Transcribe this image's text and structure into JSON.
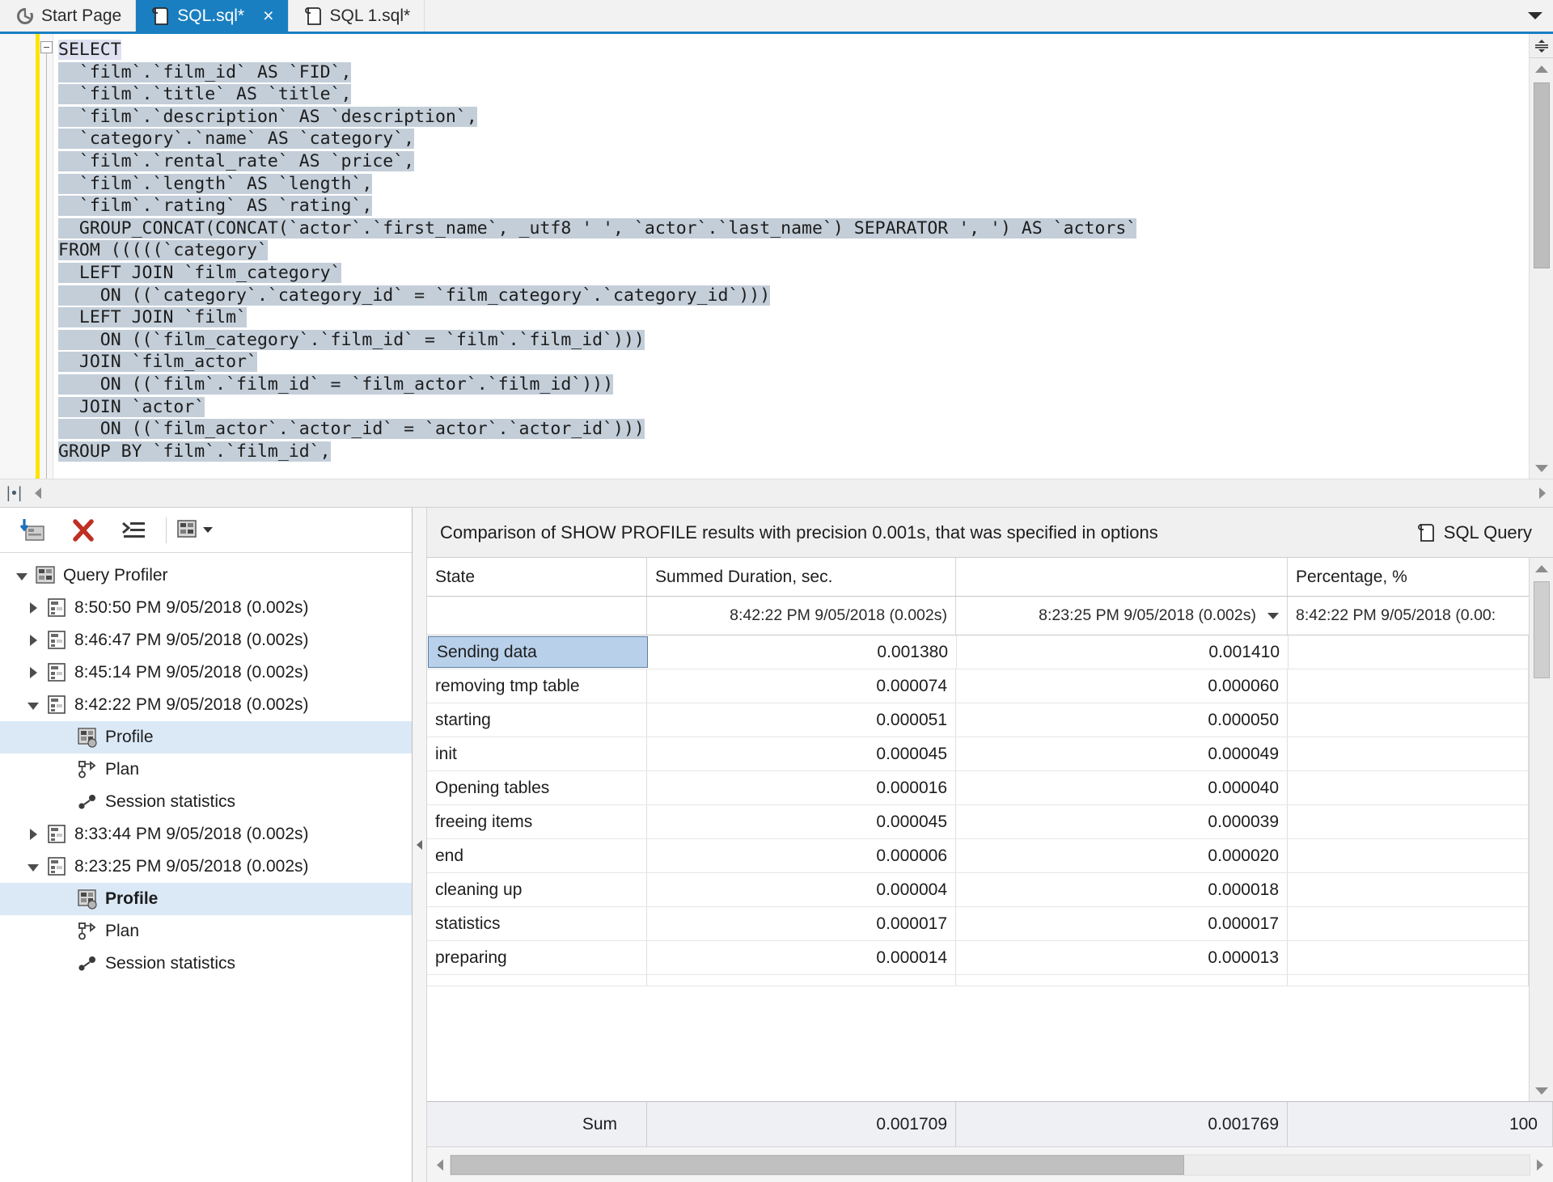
{
  "tabs": [
    {
      "label": "Start Page",
      "icon": "start-page-icon",
      "active": false,
      "closable": false
    },
    {
      "label": "SQL.sql*",
      "icon": "sql-file-icon",
      "active": true,
      "closable": true,
      "close_label": "×"
    },
    {
      "label": "SQL 1.sql*",
      "icon": "sql-file-icon",
      "active": false,
      "closable": false
    }
  ],
  "editor": {
    "lines": [
      {
        "text": "SELECT",
        "sel": "first"
      },
      {
        "text": "  `film`.`film_id` AS `FID`,",
        "sel": "yes"
      },
      {
        "text": "  `film`.`title` AS `title`,",
        "sel": "yes"
      },
      {
        "text": "  `film`.`description` AS `description`,",
        "sel": "yes"
      },
      {
        "text": "  `category`.`name` AS `category`,",
        "sel": "yes"
      },
      {
        "text": "  `film`.`rental_rate` AS `price`,",
        "sel": "yes"
      },
      {
        "text": "  `film`.`length` AS `length`,",
        "sel": "yes"
      },
      {
        "text": "  `film`.`rating` AS `rating`,",
        "sel": "yes"
      },
      {
        "text": "  GROUP_CONCAT(CONCAT(`actor`.`first_name`, _utf8 ' ', `actor`.`last_name`) SEPARATOR ', ') AS `actors`",
        "sel": "yes"
      },
      {
        "text": "FROM (((((`category`",
        "sel": "yes"
      },
      {
        "text": "  LEFT JOIN `film_category`",
        "sel": "yes"
      },
      {
        "text": "    ON ((`category`.`category_id` = `film_category`.`category_id`)))",
        "sel": "yes"
      },
      {
        "text": "  LEFT JOIN `film`",
        "sel": "yes"
      },
      {
        "text": "    ON ((`film_category`.`film_id` = `film`.`film_id`)))",
        "sel": "yes"
      },
      {
        "text": "  JOIN `film_actor`",
        "sel": "yes"
      },
      {
        "text": "    ON ((`film`.`film_id` = `film_actor`.`film_id`)))",
        "sel": "yes"
      },
      {
        "text": "  JOIN `actor`",
        "sel": "yes"
      },
      {
        "text": "    ON ((`film_actor`.`actor_id` = `actor`.`actor_id`)))",
        "sel": "yes"
      },
      {
        "text": "GROUP BY `film`.`film_id`,",
        "sel": "yes"
      }
    ]
  },
  "profiler": {
    "toolbar": [
      {
        "name": "import-profile-button",
        "icon": "import-profile-icon"
      },
      {
        "name": "delete-button",
        "icon": "red-x-icon"
      },
      {
        "name": "collapse-all-button",
        "icon": "collapse-all-icon"
      },
      {
        "name": "options-button",
        "icon": "grid-options-icon"
      }
    ],
    "root": "Query Profiler",
    "items": [
      {
        "label": "8:50:50 PM 9/05/2018 (0.002s)",
        "state": "collapsed",
        "level": 1,
        "icon": "query-result-icon"
      },
      {
        "label": "8:46:47 PM 9/05/2018 (0.002s)",
        "state": "collapsed",
        "level": 1,
        "icon": "query-result-icon"
      },
      {
        "label": "8:45:14 PM 9/05/2018 (0.002s)",
        "state": "collapsed",
        "level": 1,
        "icon": "query-result-icon"
      },
      {
        "label": "8:42:22 PM 9/05/2018 (0.002s)",
        "state": "expanded",
        "level": 1,
        "icon": "query-result-icon"
      },
      {
        "label": "Profile",
        "state": "leaf",
        "level": 2,
        "icon": "profile-icon",
        "selected": true
      },
      {
        "label": "Plan",
        "state": "leaf",
        "level": 2,
        "icon": "plan-icon"
      },
      {
        "label": "Session statistics",
        "state": "leaf",
        "level": 2,
        "icon": "session-statistics-icon"
      },
      {
        "label": "8:33:44 PM 9/05/2018 (0.002s)",
        "state": "collapsed",
        "level": 1,
        "icon": "query-result-icon"
      },
      {
        "label": "8:23:25 PM 9/05/2018 (0.002s)",
        "state": "expanded",
        "level": 1,
        "icon": "query-result-icon"
      },
      {
        "label": "Profile",
        "state": "leaf",
        "level": 2,
        "icon": "profile-icon",
        "selected": true,
        "bold": true
      },
      {
        "label": "Plan",
        "state": "leaf",
        "level": 2,
        "icon": "plan-icon"
      },
      {
        "label": "Session statistics",
        "state": "leaf",
        "level": 2,
        "icon": "session-statistics-icon"
      }
    ]
  },
  "comparison": {
    "title": "Comparison of SHOW PROFILE results with precision 0.001s, that was specified in options",
    "sql_query_label": "SQL Query",
    "sql_query_icon": "sql-file-icon",
    "columns": [
      "State",
      "Summed Duration, sec.",
      "",
      "Percentage, %"
    ],
    "subheaders": [
      "",
      "8:42:22 PM 9/05/2018 (0.002s)",
      "8:23:25 PM 9/05/2018 (0.002s)",
      "8:42:22 PM 9/05/2018 (0.00:"
    ],
    "rows": [
      {
        "state": "Sending data",
        "d1": "0.001380",
        "d2": "0.001410",
        "pct": "",
        "selected": true
      },
      {
        "state": "removing tmp table",
        "d1": "0.000074",
        "d2": "0.000060",
        "pct": ""
      },
      {
        "state": "starting",
        "d1": "0.000051",
        "d2": "0.000050",
        "pct": ""
      },
      {
        "state": "init",
        "d1": "0.000045",
        "d2": "0.000049",
        "pct": ""
      },
      {
        "state": "Opening tables",
        "d1": "0.000016",
        "d2": "0.000040",
        "pct": ""
      },
      {
        "state": "freeing items",
        "d1": "0.000045",
        "d2": "0.000039",
        "pct": ""
      },
      {
        "state": "end",
        "d1": "0.000006",
        "d2": "0.000020",
        "pct": ""
      },
      {
        "state": "cleaning up",
        "d1": "0.000004",
        "d2": "0.000018",
        "pct": ""
      },
      {
        "state": "statistics",
        "d1": "0.000017",
        "d2": "0.000017",
        "pct": ""
      },
      {
        "state": "preparing",
        "d1": "0.000014",
        "d2": "0.000013",
        "pct": ""
      }
    ],
    "sum": {
      "label": "Sum",
      "d1": "0.001709",
      "d2": "0.001769",
      "pct": "100"
    }
  },
  "chart_data": {
    "type": "table",
    "title": "Comparison of SHOW PROFILE results with precision 0.001s, that was specified in options",
    "xlabel": "State",
    "ylabel": "Summed Duration, sec.",
    "categories": [
      "Sending data",
      "removing tmp table",
      "starting",
      "init",
      "Opening tables",
      "freeing items",
      "end",
      "cleaning up",
      "statistics",
      "preparing"
    ],
    "series": [
      {
        "name": "8:42:22 PM 9/05/2018 (0.002s)",
        "values": [
          0.00138,
          7.4e-05,
          5.1e-05,
          4.5e-05,
          1.6e-05,
          4.5e-05,
          6e-06,
          4e-06,
          1.7e-05,
          1.4e-05
        ],
        "sum": 0.001709
      },
      {
        "name": "8:23:25 PM 9/05/2018 (0.002s)",
        "values": [
          0.00141,
          6e-05,
          5e-05,
          4.9e-05,
          4e-05,
          3.9e-05,
          2e-05,
          1.8e-05,
          1.7e-05,
          1.3e-05
        ],
        "sum": 0.001769
      }
    ],
    "percentage_total": 100,
    "grid": true,
    "legend": "column-headers"
  },
  "colors": {
    "tab_active_bg": "#1a7fc1",
    "selection_bg": "#c3ced9",
    "tree_selection_bg": "#dbe9f7",
    "cell_selection_bg": "#b8d0ea",
    "gutter_marker": "#ffe300",
    "delete_icon": "#c0392b"
  }
}
